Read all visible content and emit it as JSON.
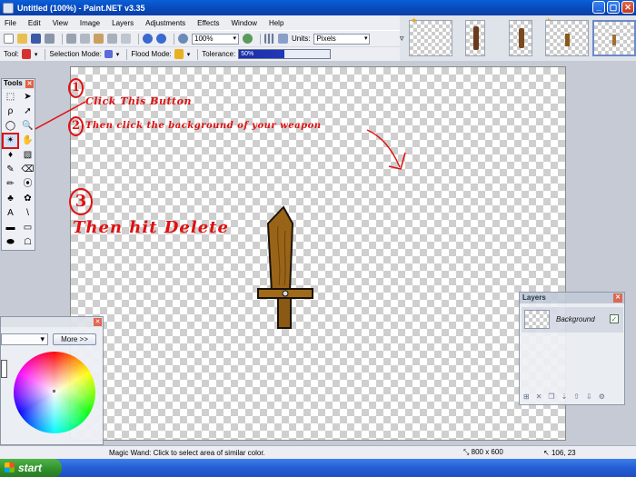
{
  "window": {
    "title": "Untitled (100%) - Paint.NET v3.35",
    "buttons": [
      "_",
      "▢",
      "✕"
    ]
  },
  "menu": [
    "File",
    "Edit",
    "View",
    "Image",
    "Layers",
    "Adjustments",
    "Effects",
    "Window",
    "Help"
  ],
  "toolbar": {
    "zoom_value": "100%",
    "units_label": "Units:",
    "units_value": "Pixels"
  },
  "tool_options": {
    "tool_label": "Tool:",
    "selection_mode_label": "Selection Mode:",
    "flood_mode_label": "Flood Mode:",
    "tolerance_label": "Tolerance:",
    "tolerance_value": "50%"
  },
  "tools_panel": {
    "title": "Tools",
    "close": "✕",
    "items": [
      {
        "name": "rectangle-select",
        "glyph": "⬚"
      },
      {
        "name": "move-selection",
        "glyph": "➤"
      },
      {
        "name": "lasso-select",
        "glyph": "ρ"
      },
      {
        "name": "move-selected",
        "glyph": "➚"
      },
      {
        "name": "ellipse-select",
        "glyph": "◯"
      },
      {
        "name": "zoom",
        "glyph": "🔍"
      },
      {
        "name": "magic-wand",
        "glyph": "✴"
      },
      {
        "name": "pan",
        "glyph": "✋"
      },
      {
        "name": "paint-bucket",
        "glyph": "♦"
      },
      {
        "name": "gradient",
        "glyph": "▧"
      },
      {
        "name": "paintbrush",
        "glyph": "✎"
      },
      {
        "name": "eraser",
        "glyph": "⌫"
      },
      {
        "name": "pencil",
        "glyph": "✏"
      },
      {
        "name": "color-picker",
        "glyph": "⦿"
      },
      {
        "name": "clone-stamp",
        "glyph": "♣"
      },
      {
        "name": "recolor",
        "glyph": "✿"
      },
      {
        "name": "text",
        "glyph": "A"
      },
      {
        "name": "line-curve",
        "glyph": "\\"
      },
      {
        "name": "rectangle",
        "glyph": "▬"
      },
      {
        "name": "rounded-rectangle",
        "glyph": "▭"
      },
      {
        "name": "ellipse",
        "glyph": "⬬"
      },
      {
        "name": "freeform-shape",
        "glyph": "☖"
      }
    ]
  },
  "annotations": {
    "step1_number": "1",
    "step1_text": "Click This Button",
    "step2_number": "2",
    "step2_text": "Then click the background of your weapon",
    "step3_number": "3",
    "step3_text": "Then hit Delete"
  },
  "colors_panel": {
    "more_button": "More >>",
    "dropdown_arrow": "▾"
  },
  "layers_panel": {
    "title": "Layers",
    "close": "✕",
    "layer_name": "Background",
    "layer_visible_mark": "✓"
  },
  "status": {
    "text": "Magic Wand: Click to select area of similar color.",
    "image_size": "800 x 600",
    "cursor_pos": "106, 23"
  },
  "taskbar": {
    "start_label": "start"
  }
}
